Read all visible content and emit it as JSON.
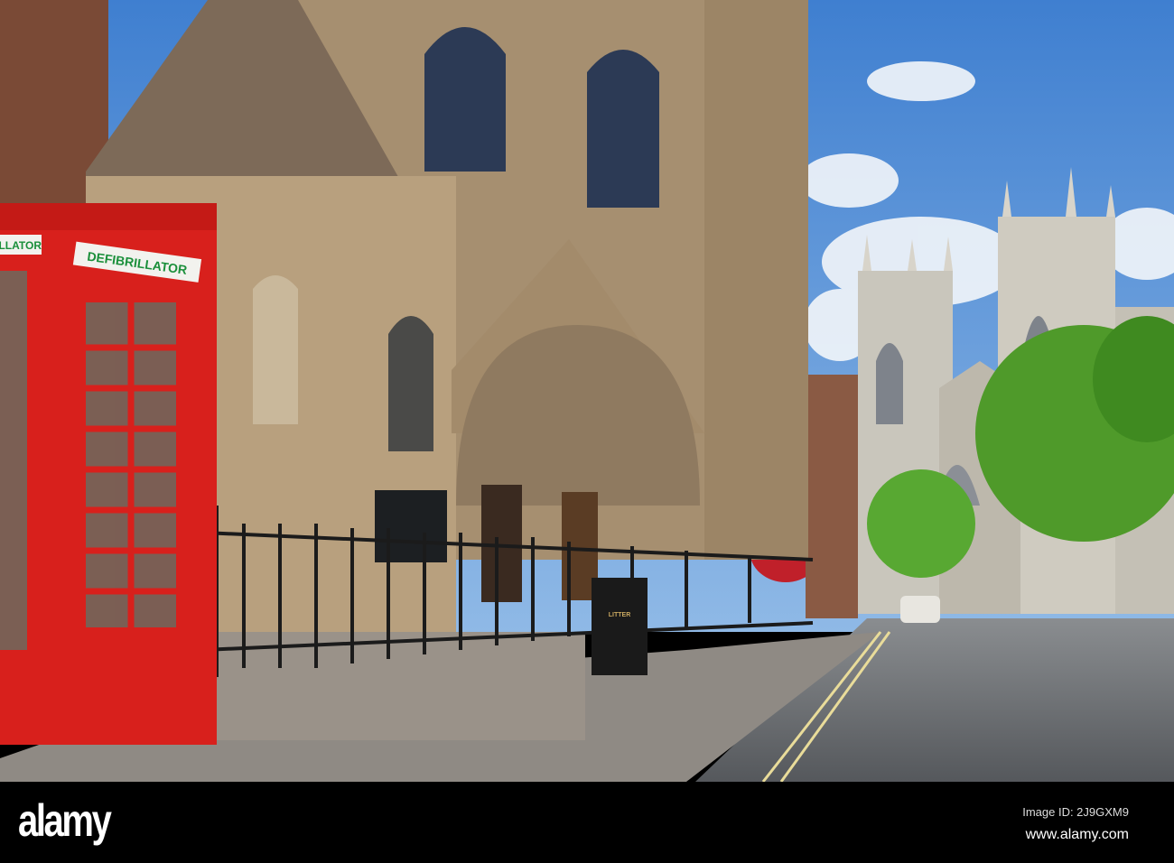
{
  "photo": {
    "defibrillator_sign_front": "DEFIBRILLATOR",
    "defibrillator_sign_side": "DEFIBRILLATOR",
    "litter_bin_label": "LITTER",
    "colors": {
      "sky": "#4f8fd6",
      "stone": "#b49a78",
      "phone_box": "#d8201c",
      "road": "#6b6e72",
      "tree": "#4f9a2a"
    }
  },
  "watermark": {
    "logo": "alamy",
    "image_id": "Image ID: 2J9GXM9",
    "url": "www.alamy.com"
  }
}
